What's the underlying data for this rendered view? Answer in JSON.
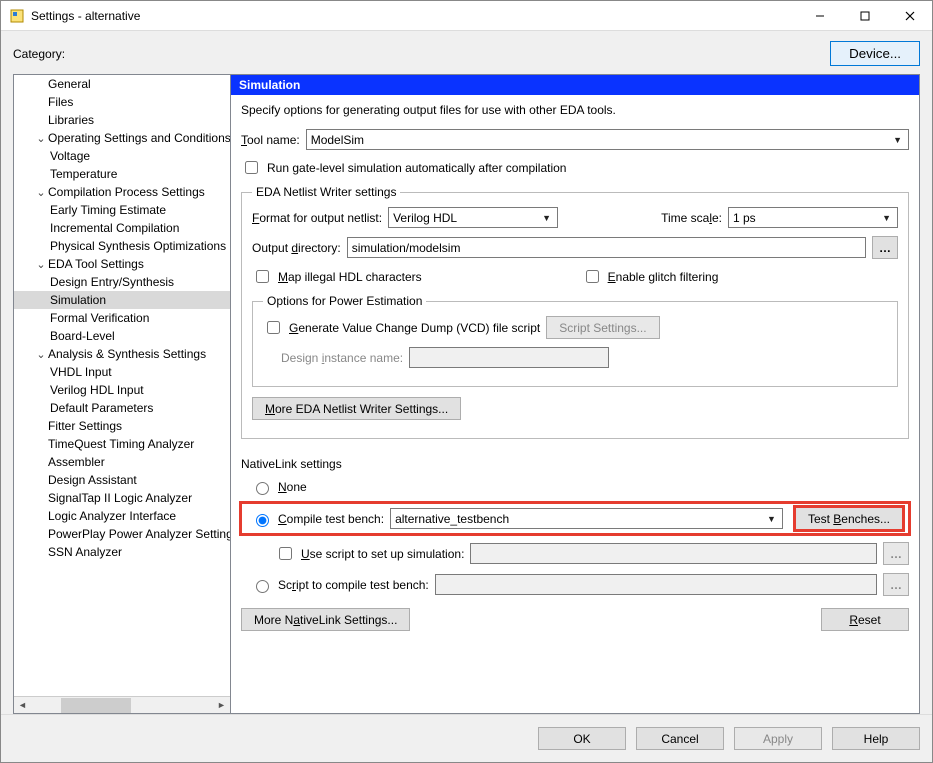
{
  "window": {
    "title": "Settings - alternative",
    "min_tt": "Minimize",
    "max_tt": "Maximize",
    "close_tt": "Close"
  },
  "top": {
    "category_label": "Category:",
    "device_btn": "Device..."
  },
  "tree": {
    "items": [
      {
        "label": "General",
        "indent": 0
      },
      {
        "label": "Files",
        "indent": 0
      },
      {
        "label": "Libraries",
        "indent": 0
      },
      {
        "label": "Operating Settings and Conditions",
        "indent": 0,
        "expander": "v"
      },
      {
        "label": "Voltage",
        "indent": 1
      },
      {
        "label": "Temperature",
        "indent": 1
      },
      {
        "label": "Compilation Process Settings",
        "indent": 0,
        "expander": "v"
      },
      {
        "label": "Early Timing Estimate",
        "indent": 1
      },
      {
        "label": "Incremental Compilation",
        "indent": 1
      },
      {
        "label": "Physical Synthesis Optimizations",
        "indent": 1
      },
      {
        "label": "EDA Tool Settings",
        "indent": 0,
        "expander": "v"
      },
      {
        "label": "Design Entry/Synthesis",
        "indent": 1
      },
      {
        "label": "Simulation",
        "indent": 1,
        "selected": true
      },
      {
        "label": "Formal Verification",
        "indent": 1
      },
      {
        "label": "Board-Level",
        "indent": 1
      },
      {
        "label": "Analysis & Synthesis Settings",
        "indent": 0,
        "expander": "v"
      },
      {
        "label": "VHDL Input",
        "indent": 1
      },
      {
        "label": "Verilog HDL Input",
        "indent": 1
      },
      {
        "label": "Default Parameters",
        "indent": 1
      },
      {
        "label": "Fitter Settings",
        "indent": 0
      },
      {
        "label": "TimeQuest Timing Analyzer",
        "indent": 0
      },
      {
        "label": "Assembler",
        "indent": 0
      },
      {
        "label": "Design Assistant",
        "indent": 0
      },
      {
        "label": "SignalTap II Logic Analyzer",
        "indent": 0
      },
      {
        "label": "Logic Analyzer Interface",
        "indent": 0
      },
      {
        "label": "PowerPlay Power Analyzer Settings",
        "indent": 0
      },
      {
        "label": "SSN Analyzer",
        "indent": 0
      }
    ]
  },
  "main": {
    "section_title": "Simulation",
    "section_desc": "Specify options for generating output files for use with other EDA tools.",
    "tool_name_label": "Tool name:",
    "tool_name_value": "ModelSim",
    "run_gate_label": "Run gate-level simulation automatically after compilation",
    "netlist": {
      "legend": "EDA Netlist Writer settings",
      "format_label": "Format for output netlist:",
      "format_value": "Verilog HDL",
      "time_scale_label": "Time scale:",
      "time_scale_value": "1 ps",
      "outdir_label": "Output directory:",
      "outdir_value": "simulation/modelsim",
      "map_illegal_label": "Map illegal HDL characters",
      "glitch_label": "Enable glitch filtering",
      "power_legend": "Options for Power Estimation",
      "gen_vcd_label": "Generate Value Change Dump (VCD) file script",
      "script_settings_btn": "Script Settings...",
      "design_inst_label": "Design instance name:",
      "more_netlist_btn": "More EDA Netlist Writer Settings..."
    },
    "nativelink": {
      "legend": "NativeLink settings",
      "none_label": "None",
      "compile_tb_label": "Compile test bench:",
      "compile_tb_value": "alternative_testbench",
      "test_benches_btn": "Test Benches...",
      "use_script_label": "Use script to set up simulation:",
      "script_compile_label": "Script to compile test bench:",
      "more_native_btn": "More NativeLink Settings...",
      "reset_btn": "Reset"
    }
  },
  "dialog": {
    "ok": "OK",
    "cancel": "Cancel",
    "apply": "Apply",
    "help": "Help"
  }
}
